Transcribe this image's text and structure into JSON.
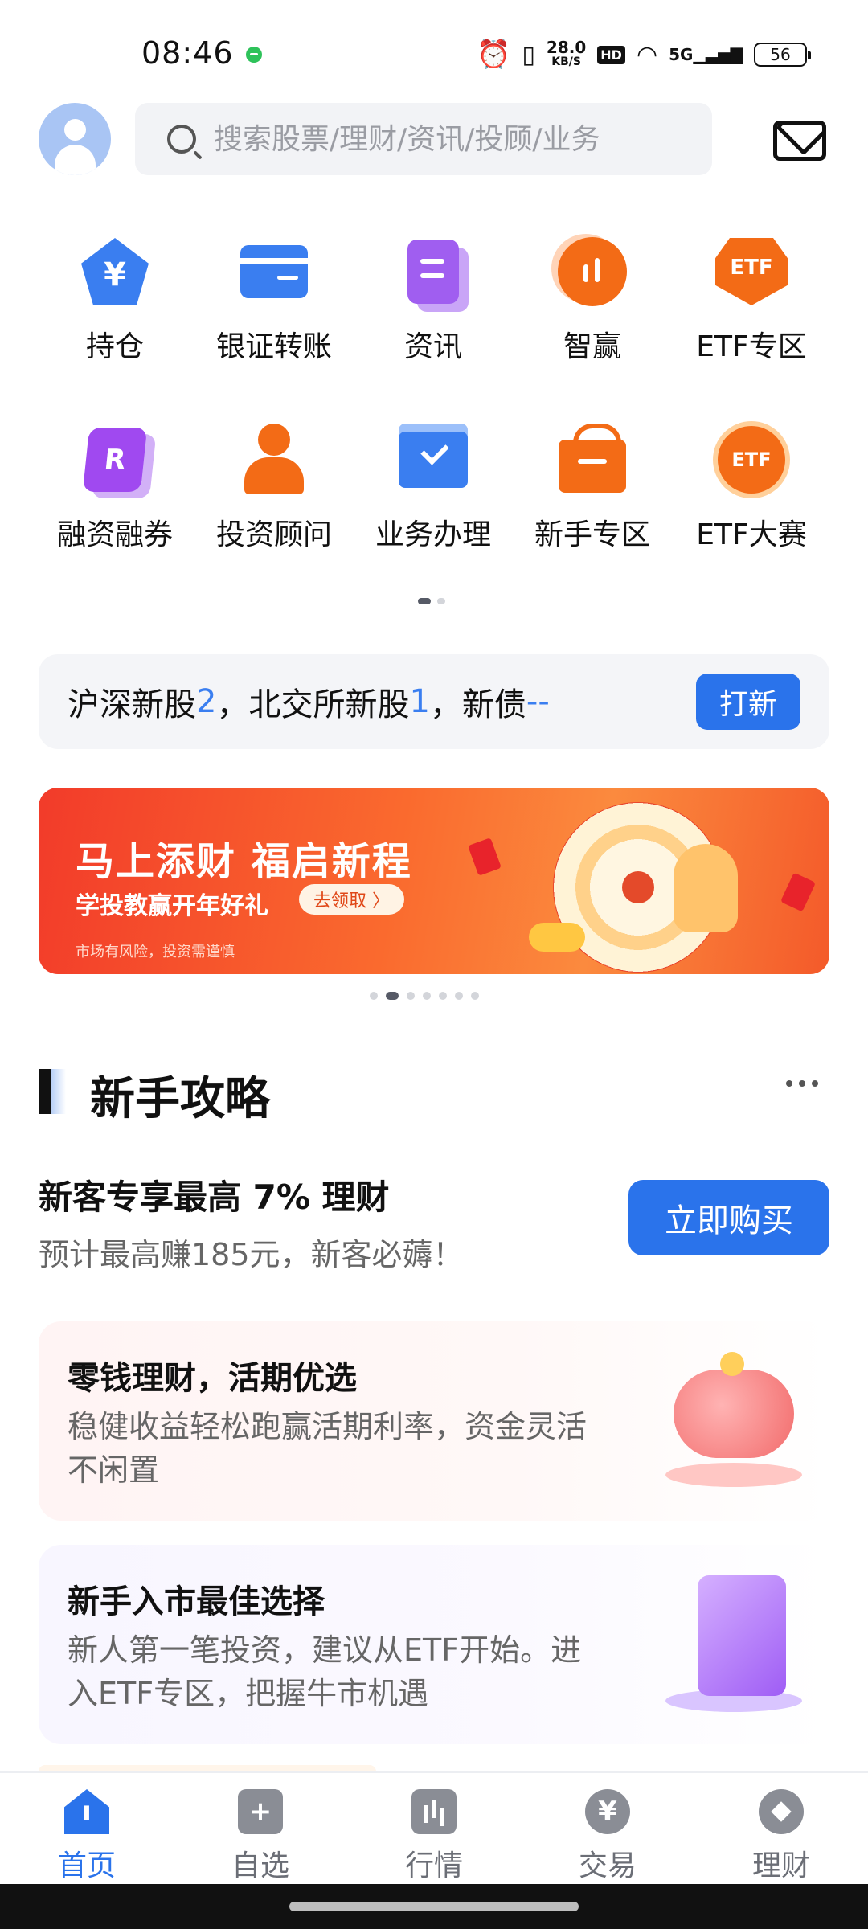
{
  "status_bar": {
    "time": "08:46",
    "net_speed": "28.0",
    "net_unit": "KB/S",
    "hd": "HD",
    "signal": "5G",
    "battery": "56"
  },
  "header": {
    "search_placeholder": "搜索股票/理财/资讯/投顾/业务"
  },
  "quick_grid": [
    {
      "label": "持仓",
      "icon": "wallet-yuan-icon",
      "glyph": "¥"
    },
    {
      "label": "银证转账",
      "icon": "bank-card-icon",
      "glyph": ""
    },
    {
      "label": "资讯",
      "icon": "news-doc-icon",
      "glyph": ""
    },
    {
      "label": "智赢",
      "icon": "chart-circle-icon",
      "glyph": ""
    },
    {
      "label": "ETF专区",
      "icon": "etf-badge-icon",
      "glyph": "ETF"
    },
    {
      "label": "融资融券",
      "icon": "margin-r-icon",
      "glyph": "R"
    },
    {
      "label": "投资顾问",
      "icon": "advisor-person-icon",
      "glyph": ""
    },
    {
      "label": "业务办理",
      "icon": "folder-check-icon",
      "glyph": ""
    },
    {
      "label": "新手专区",
      "icon": "gift-box-icon",
      "glyph": ""
    },
    {
      "label": "ETF大赛",
      "icon": "etf-medal-icon",
      "glyph": "ETF"
    }
  ],
  "ipo_bar": {
    "part1": "沪深新股",
    "num1": "2",
    "part2": "，北交所新股",
    "num2": "1",
    "part3": "，新债",
    "num3": "--",
    "button": "打新"
  },
  "banner": {
    "title": "马上添财 福启新程",
    "subtitle": "学投教赢开年好礼",
    "button": "去领取 〉",
    "risk_note": "市场有风险，投资需谨慎",
    "slides": 7,
    "active_slide": 2
  },
  "section": {
    "title": "新手攻略",
    "promo": {
      "title": "新客专享最高 7% 理财",
      "subtitle": "预计最高赚185元，新客必薅！",
      "button": "立即购买"
    },
    "cards": [
      {
        "title": "零钱理财，活期优选",
        "desc": "稳健收益轻松跑赢活期利率，资金灵活不闲置",
        "icon": "piggy-bank-icon"
      },
      {
        "title": "新手入市最佳选择",
        "desc": "新人第一笔投资，建议从ETF开始。进入ETF专区，把握牛市机遇",
        "icon": "scroll-chart-icon"
      }
    ]
  },
  "tabbar": [
    {
      "label": "首页",
      "icon": "home-icon",
      "glyph": "ı",
      "active": true
    },
    {
      "label": "自选",
      "icon": "plus-square-icon",
      "glyph": "+",
      "active": false
    },
    {
      "label": "行情",
      "icon": "market-bars-icon",
      "glyph": "",
      "active": false
    },
    {
      "label": "交易",
      "icon": "yuan-circle-icon",
      "glyph": "¥",
      "active": false
    },
    {
      "label": "理财",
      "icon": "diamond-circle-icon",
      "glyph": "",
      "active": false
    }
  ],
  "colors": {
    "accent": "#2a73eb",
    "orange": "#f36b16",
    "purple": "#a05ef0"
  }
}
